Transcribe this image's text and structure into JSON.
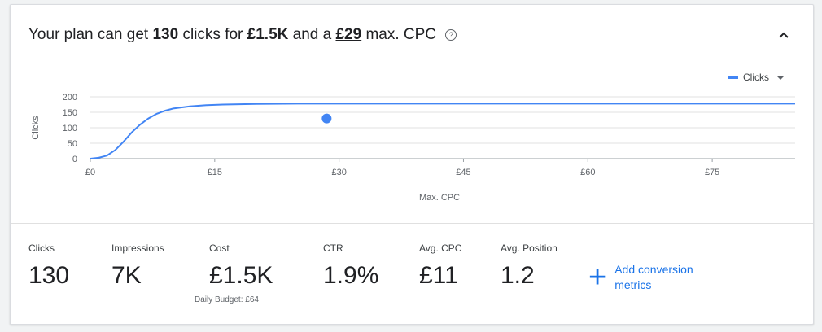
{
  "header": {
    "prefix": "Your plan can get",
    "clicks": "130",
    "mid1": "clicks for",
    "cost": "£1.5K",
    "mid2": "and a",
    "cpc": "£29",
    "suffix": "max. CPC",
    "help_glyph": "?"
  },
  "legend": {
    "label": "Clicks",
    "color": "#4285f4"
  },
  "chart_data": {
    "type": "line",
    "xlabel": "Max. CPC",
    "ylabel": "Clicks",
    "xlim": [
      0,
      85
    ],
    "ylim": [
      0,
      200
    ],
    "x_ticks": [
      "£0",
      "£15",
      "£30",
      "£45",
      "£60",
      "£75"
    ],
    "x_tick_values": [
      0,
      15,
      30,
      45,
      60,
      75
    ],
    "y_ticks": [
      "0",
      "50",
      "100",
      "150",
      "200"
    ],
    "y_tick_values": [
      0,
      50,
      100,
      150,
      200
    ],
    "grid": true,
    "legend_position": "top-right",
    "series": [
      {
        "name": "Clicks",
        "color": "#4285f4",
        "x": [
          0,
          1,
          2,
          3,
          4,
          5,
          6,
          7,
          8,
          9,
          10,
          12,
          14,
          16,
          18,
          20,
          25,
          30,
          40,
          50,
          60,
          70,
          80,
          85
        ],
        "y": [
          0,
          3,
          10,
          28,
          55,
          85,
          110,
          130,
          145,
          155,
          162,
          169,
          173,
          175,
          176,
          177,
          178,
          178,
          178,
          178,
          178,
          178,
          178,
          178
        ]
      }
    ],
    "selected_point": {
      "x": 28.5,
      "y": 130
    }
  },
  "metrics": [
    {
      "label": "Clicks",
      "value": "130"
    },
    {
      "label": "Impressions",
      "value": "7K"
    },
    {
      "label": "Cost",
      "value": "£1.5K"
    },
    {
      "label": "CTR",
      "value": "1.9%"
    },
    {
      "label": "Avg. CPC",
      "value": "£11"
    },
    {
      "label": "Avg. Position",
      "value": "1.2"
    }
  ],
  "daily_budget": "Daily Budget: £64",
  "add_conversion": {
    "icon": "+",
    "label": "Add conversion metrics"
  }
}
